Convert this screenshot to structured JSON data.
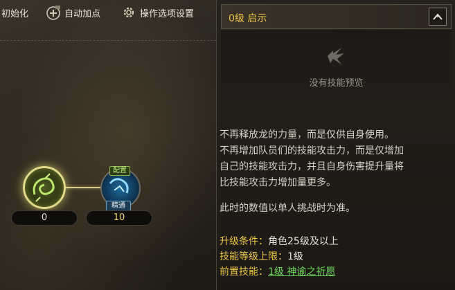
{
  "toolbar": {
    "reset_label": "初始化",
    "auto_label": "自动加点",
    "settings_label": "操作选项设置"
  },
  "skill_tree": {
    "nodes": [
      {
        "level": "0",
        "icon": "green-dragon-skill-icon"
      },
      {
        "level": "10",
        "icon": "blue-skill-icon",
        "badge_top": "配置",
        "badge_bottom": "精通"
      }
    ]
  },
  "detail": {
    "title": "0级 启示",
    "preview_text": "没有技能预览",
    "description": [
      "不再释放龙的力量，而是仅供自身使用。",
      "不再增加队员们的技能攻击力，而是仅增加",
      "自己的技能攻击力，并且自身伤害提升量将",
      "比技能攻击力增加量更多。",
      "此时的数值以单人挑战时为准。"
    ],
    "requirement_label": "升级条件：",
    "requirement_value": "角色25级及以上",
    "max_level_label": "技能等级上限：",
    "max_level_value": "1级",
    "prereq_label": "前置技能：",
    "prereq_value": "1级 神谕之祈愿"
  },
  "colors": {
    "gold": "#f0c846",
    "green_link": "#6ed85a",
    "level_gold": "#f0d870"
  }
}
